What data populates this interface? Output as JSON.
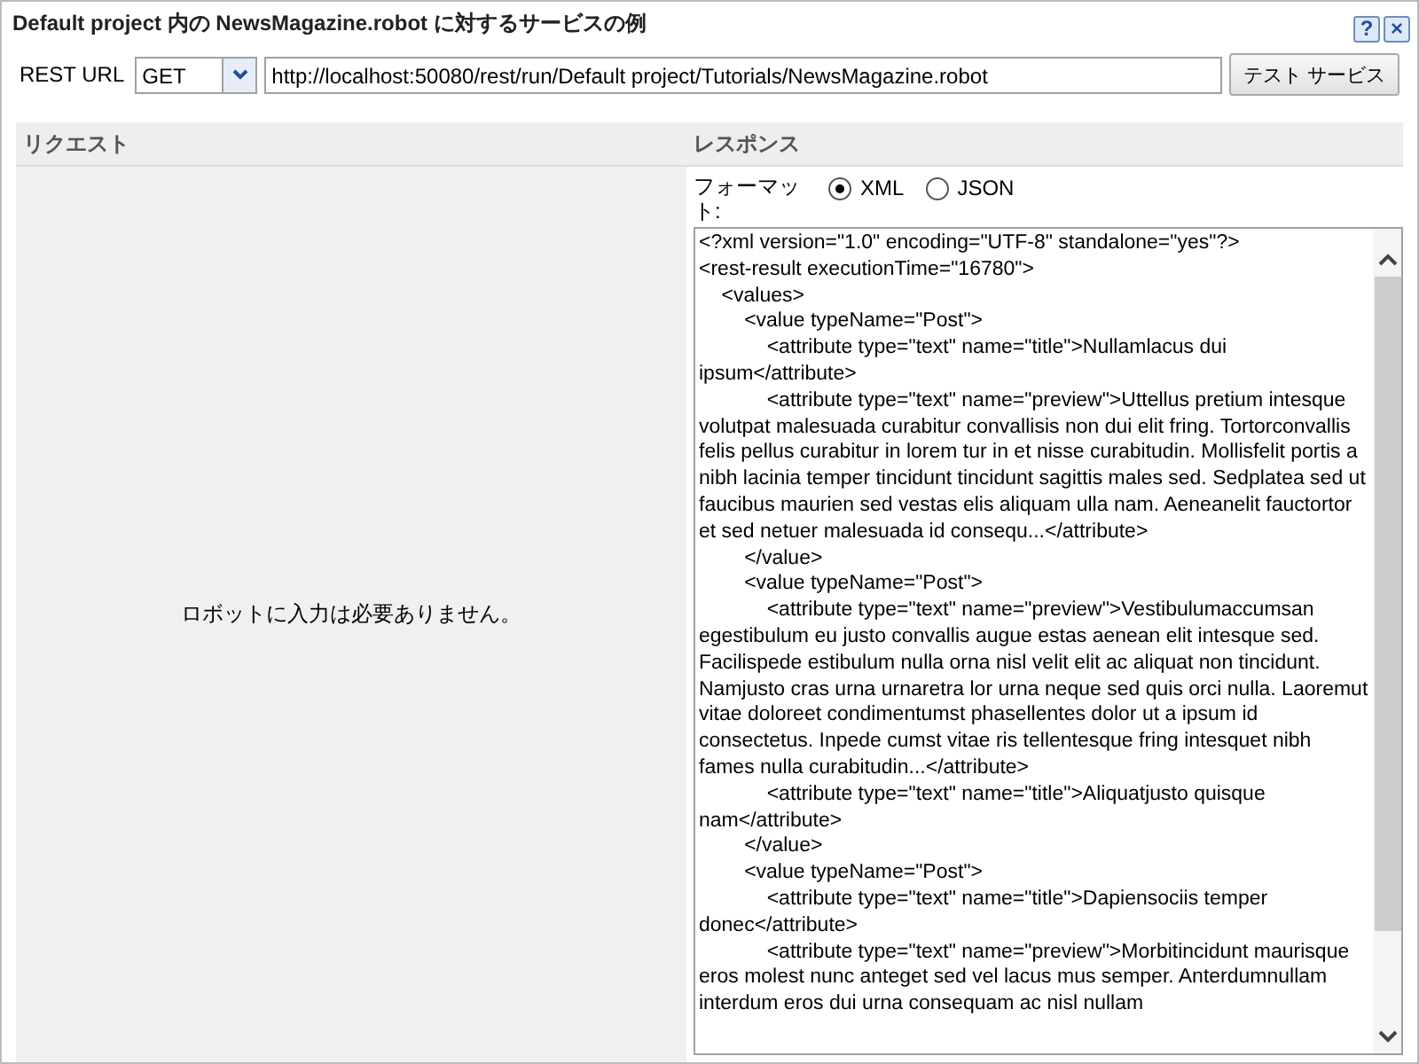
{
  "window": {
    "title": "Default project 内の NewsMagazine.robot に対するサービスの例",
    "help_button": "?",
    "close_button": "×"
  },
  "request_bar": {
    "label": "REST URL",
    "method": "GET",
    "url": "http://localhost:50080/rest/run/Default project/Tutorials/NewsMagazine.robot",
    "test_button": "テスト サービス"
  },
  "request": {
    "heading": "リクエスト",
    "message": "ロボットに入力は必要ありません。"
  },
  "response": {
    "heading": "レスポンス",
    "format_label": "フォーマット:",
    "formats": [
      {
        "label": "XML",
        "selected": true
      },
      {
        "label": "JSON",
        "selected": false
      }
    ],
    "text": "<?xml version=\"1.0\" encoding=\"UTF-8\" standalone=\"yes\"?>\n<rest-result executionTime=\"16780\">\n    <values>\n        <value typeName=\"Post\">\n            <attribute type=\"text\" name=\"title\">Nullamlacus dui ipsum</attribute>\n            <attribute type=\"text\" name=\"preview\">Uttellus pretium intesque volutpat malesuada curabitur convallisis non dui elit fring. Tortorconvallis felis pellus curabitur in lorem tur in et nisse curabitudin. Mollisfelit portis a nibh lacinia temper tincidunt tincidunt sagittis males sed. Sedplatea sed ut faucibus maurien sed vestas elis aliquam ulla nam. Aeneanelit fauctortor et sed netuer malesuada id consequ...</attribute>\n        </value>\n        <value typeName=\"Post\">\n            <attribute type=\"text\" name=\"preview\">Vestibulumaccumsan egestibulum eu justo convallis augue estas aenean elit intesque sed. Facilispede estibulum nulla orna nisl velit elit ac aliquat non tincidunt. Namjusto cras urna urnaretra lor urna neque sed quis orci nulla. Laoremut vitae doloreet condimentumst phasellentes dolor ut a ipsum id consectetus. Inpede cumst vitae ris tellentesque fring intesquet nibh fames nulla curabitudin...</attribute>\n            <attribute type=\"text\" name=\"title\">Aliquatjusto quisque nam</attribute>\n        </value>\n        <value typeName=\"Post\">\n            <attribute type=\"text\" name=\"title\">Dapiensociis temper donec</attribute>\n            <attribute type=\"text\" name=\"preview\">Morbitincidunt maurisque eros molest nunc anteget sed vel lacus mus semper. Anterdumnullam interdum eros dui urna consequam ac nisl nullam"
  }
}
